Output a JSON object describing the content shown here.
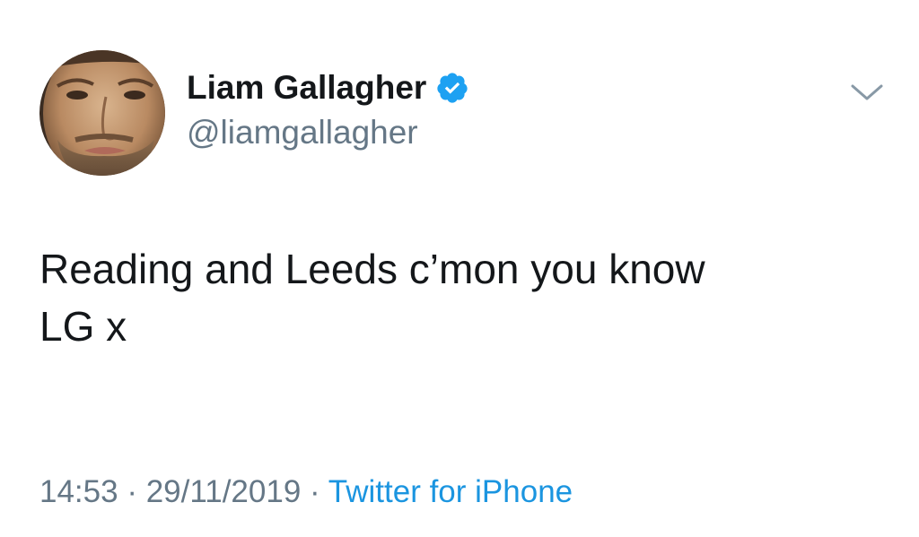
{
  "user": {
    "display_name": "Liam Gallagher",
    "handle": "@liamgallagher",
    "verified": true,
    "avatar_icon": "profile-photo"
  },
  "tweet": {
    "text": "Reading and Leeds c’mon you know\nLG x"
  },
  "meta": {
    "time": "14:53",
    "separator": "·",
    "date": "29/11/2019",
    "source": "Twitter for iPhone"
  },
  "icons": {
    "verified": "verified-badge-icon",
    "menu": "chevron-down-icon"
  },
  "colors": {
    "text": "#14171a",
    "secondary": "#657786",
    "accent": "#1b95e0",
    "verified": "#1da1f2"
  }
}
